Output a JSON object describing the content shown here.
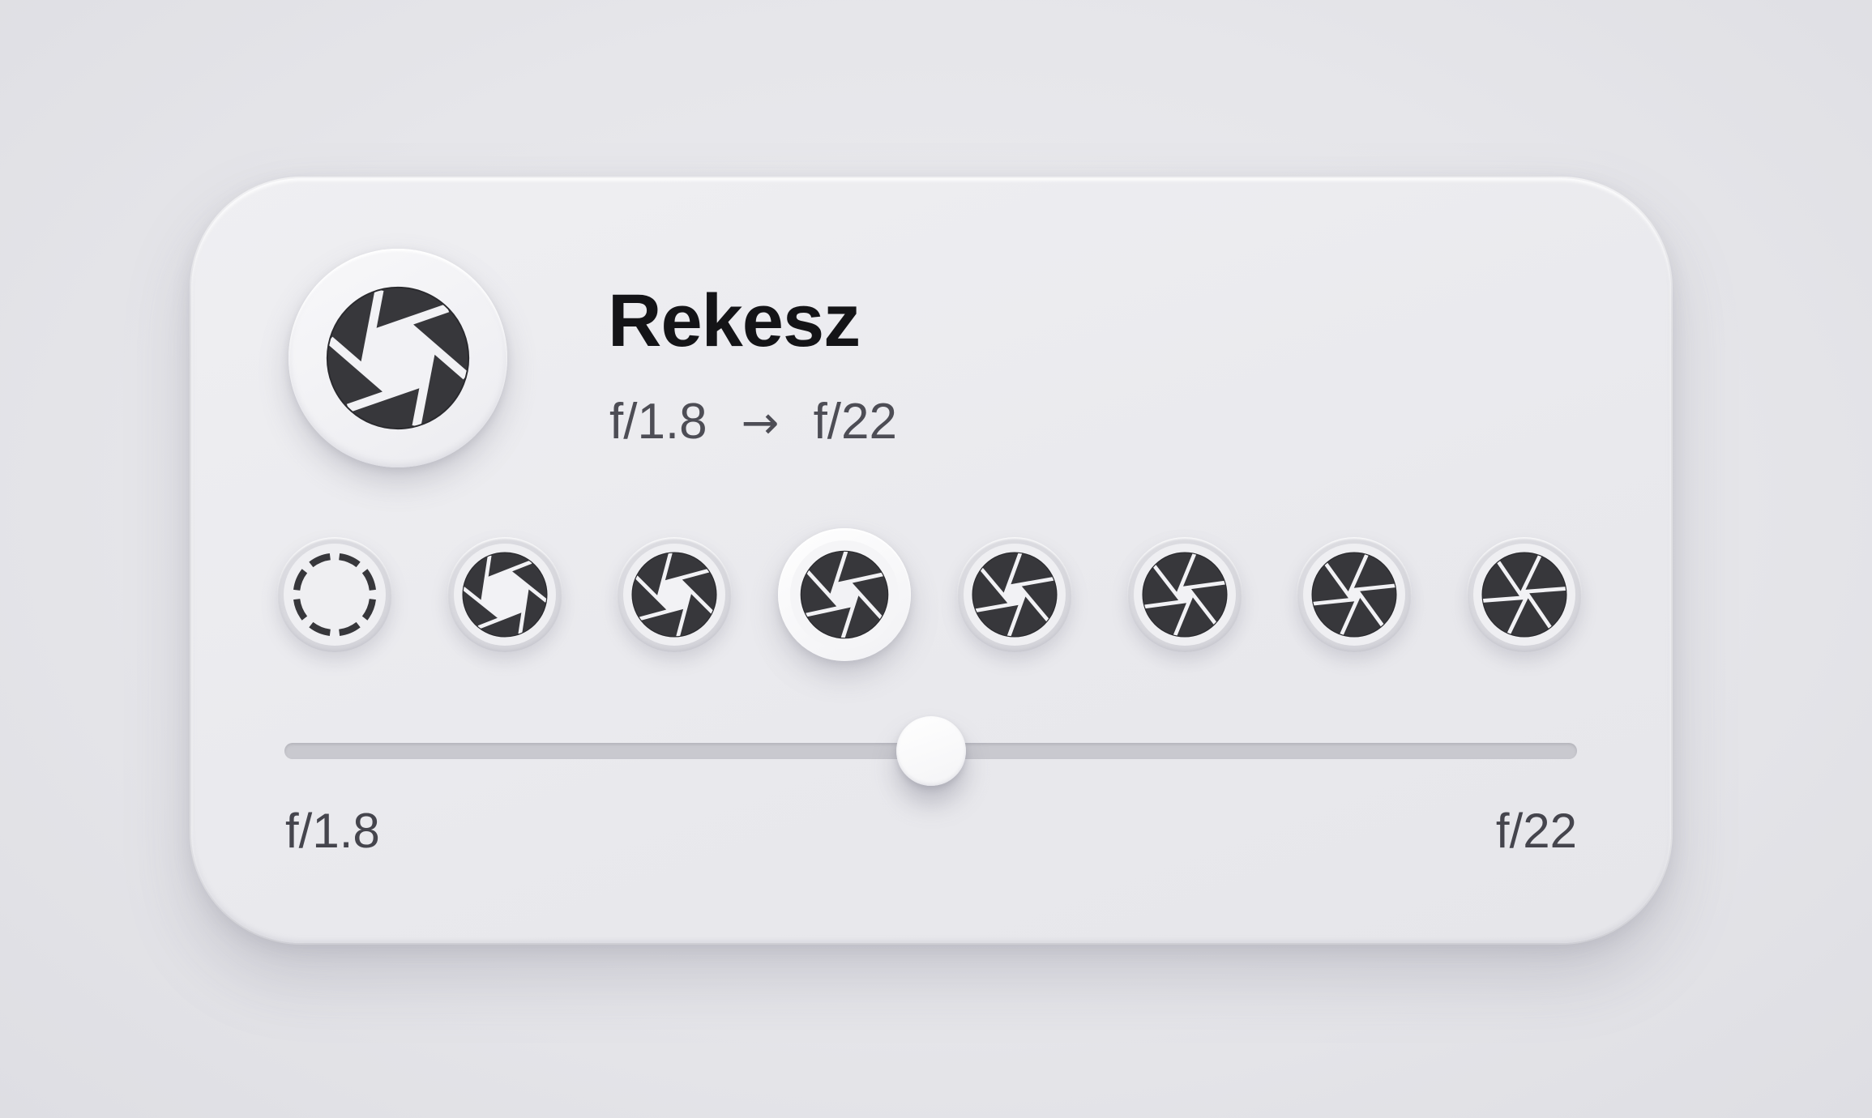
{
  "widget": {
    "title": "Rekesz",
    "range_from": "f/1.8",
    "range_arrow": "→",
    "range_to": "f/22",
    "hero_icon": "aperture-icon"
  },
  "stops": {
    "icon": "aperture-icon",
    "openings": [
      1.0,
      0.7,
      0.48,
      0.38,
      0.3,
      0.22,
      0.16,
      0.1
    ],
    "selected_index": 3
  },
  "slider": {
    "value": 0.5,
    "min_label": "f/1.8",
    "max_label": "f/22"
  },
  "colors": {
    "blade": "#37373b",
    "background": "#e8e8ec",
    "track": "#c9c9cf",
    "thumb": "#ffffff"
  }
}
